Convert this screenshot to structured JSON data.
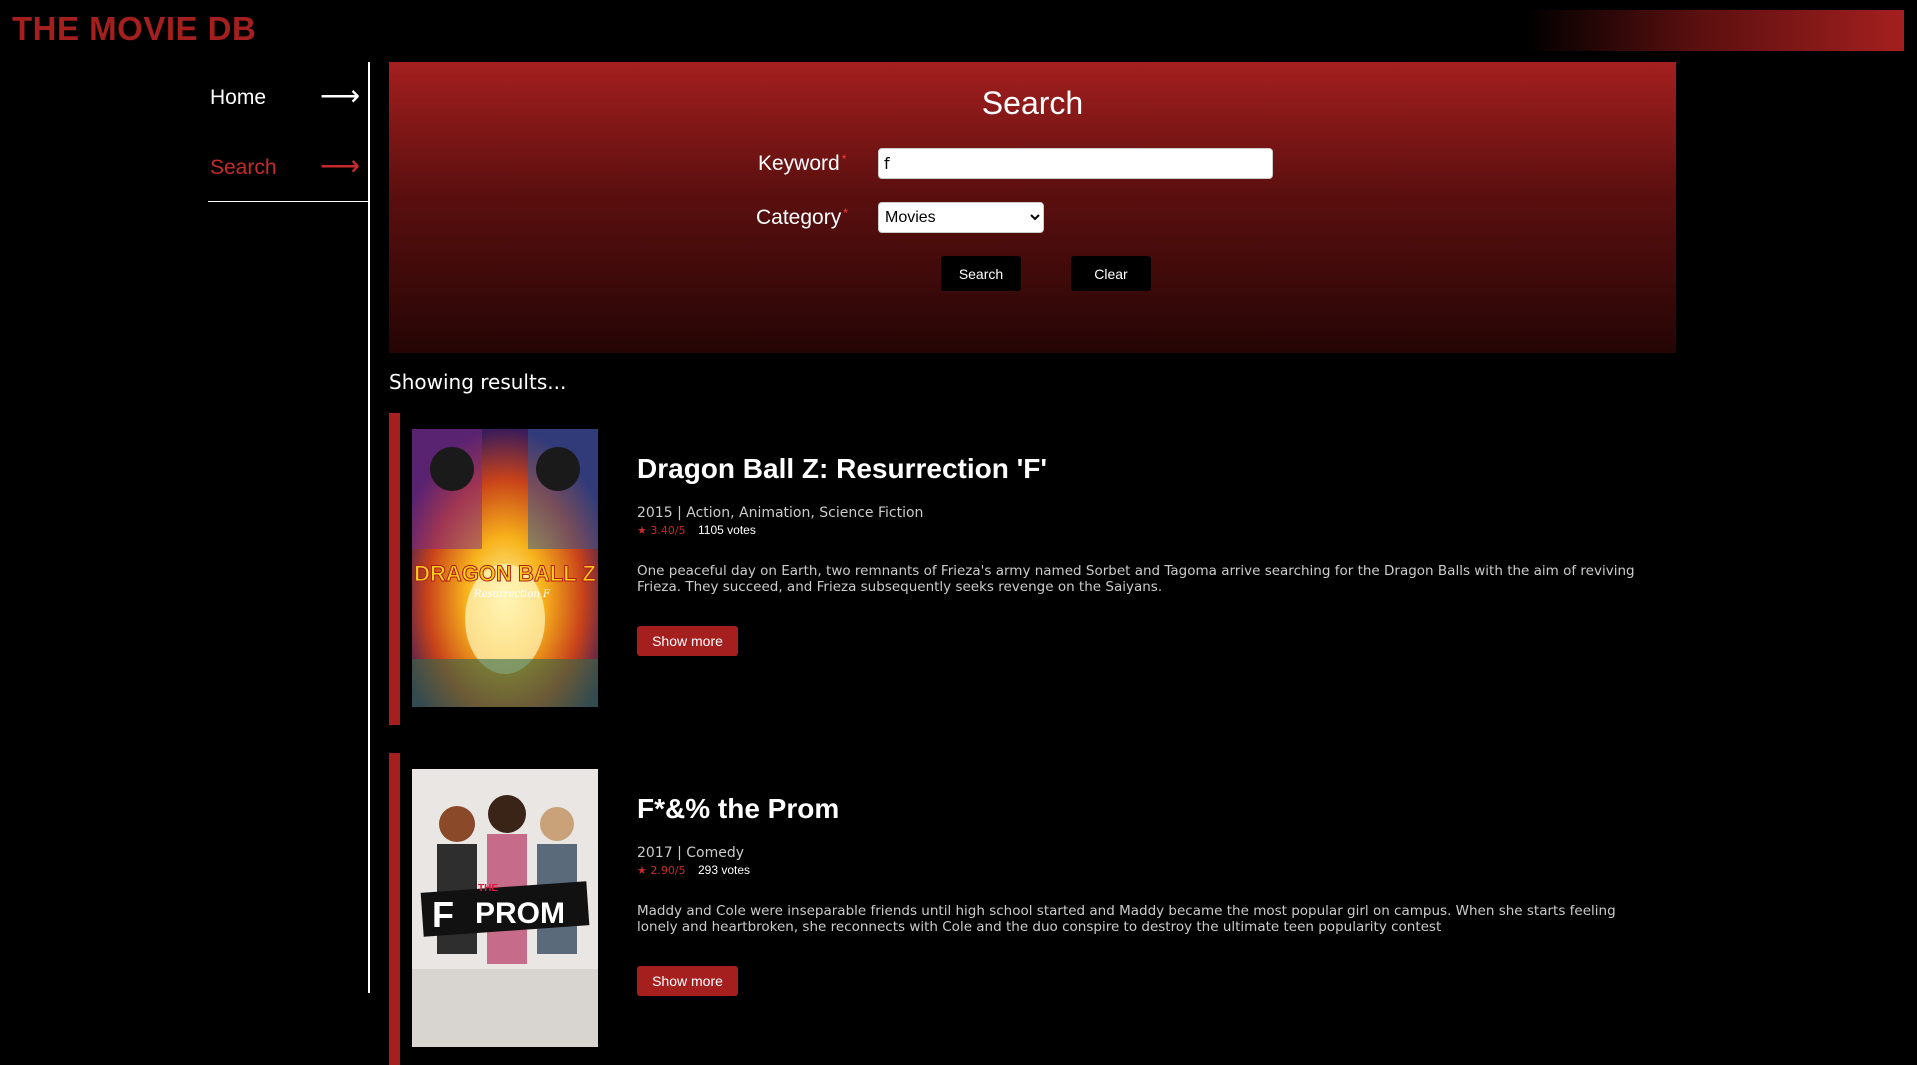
{
  "header": {
    "brand": "THE MOVIE DB"
  },
  "sidebar": {
    "items": [
      {
        "label": "Home",
        "arrow": "⟶"
      },
      {
        "label": "Search",
        "arrow": "⟶"
      }
    ]
  },
  "search_panel": {
    "title": "Search",
    "keyword_label": "Keyword",
    "required_mark": "*",
    "keyword_value": "f",
    "category_label": "Category",
    "category_selected": "Movies",
    "search_button": "Search",
    "clear_button": "Clear"
  },
  "results": {
    "heading": "Showing results...",
    "items": [
      {
        "title": "Dragon Ball Z: Resurrection 'F'",
        "meta": "2015 | Action, Animation, Science Fiction",
        "rating": "★ 3.40/5",
        "votes": "1105 votes",
        "overview": "One peaceful day on Earth, two remnants of Frieza's army named Sorbet and Tagoma arrive searching for the Dragon Balls with the aim of reviving Frieza. They succeed, and Frieza subsequently seeks revenge on the Saiyans.",
        "show_more": "Show more",
        "poster_text": "DRAGON BALL Z",
        "poster_subtext": "Resurrection F"
      },
      {
        "title": "F*&% the Prom",
        "meta": "2017 | Comedy",
        "rating": "★ 2.90/5",
        "votes": "293 votes",
        "overview": "Maddy and Cole were inseparable friends until high school started and Maddy became the most popular girl on campus. When she starts feeling lonely and heartbroken, she reconnects with Cole and the duo conspire to destroy the ultimate teen popularity contest",
        "show_more": "Show more",
        "poster_text": "PROM",
        "poster_subtext": "THE"
      }
    ]
  },
  "colors": {
    "accent": "#a51f1f",
    "active_nav": "#c62a2a",
    "background": "#000000"
  }
}
